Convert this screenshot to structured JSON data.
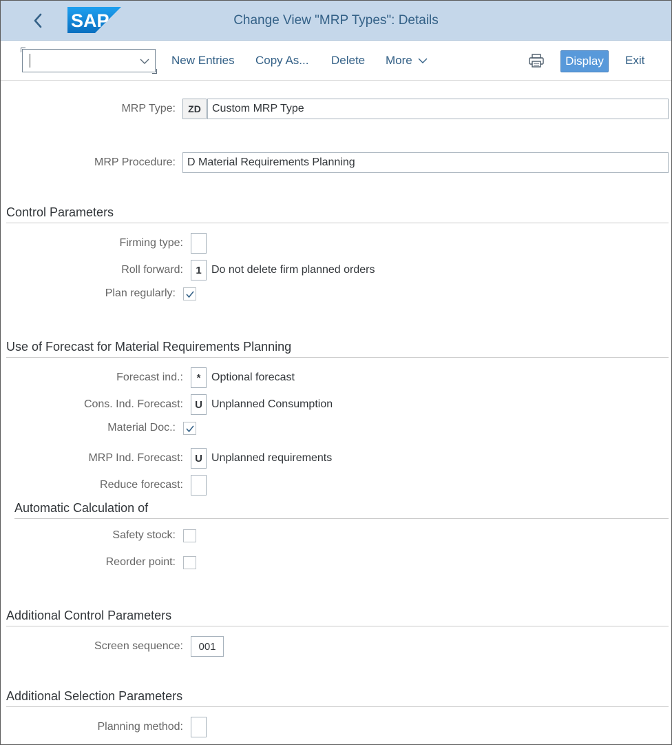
{
  "header": {
    "title": "Change View \"MRP Types\": Details",
    "logo_text": "SAP"
  },
  "toolbar": {
    "command_value": "",
    "new_entries": "New Entries",
    "copy_as": "Copy As...",
    "delete": "Delete",
    "more": "More",
    "display": "Display",
    "exit": "Exit"
  },
  "form": {
    "mrp_type_label": "MRP Type:",
    "mrp_type_code": "ZD",
    "mrp_type_desc": "Custom MRP Type",
    "mrp_procedure_label": "MRP Procedure:",
    "mrp_procedure_value": "D Material Requirements Planning"
  },
  "control": {
    "title": "Control Parameters",
    "firming_type_label": "Firming type:",
    "firming_type_value": "",
    "roll_forward_label": "Roll forward:",
    "roll_forward_value": "1",
    "roll_forward_desc": "Do not delete firm planned orders",
    "plan_regularly_label": "Plan regularly:",
    "plan_regularly_checked": true
  },
  "forecast": {
    "title": "Use of Forecast for Material Requirements Planning",
    "forecast_ind_label": "Forecast ind.:",
    "forecast_ind_value": "*",
    "forecast_ind_desc": "Optional forecast",
    "cons_ind_label": "Cons. Ind. Forecast:",
    "cons_ind_value": "U",
    "cons_ind_desc": "Unplanned Consumption",
    "material_doc_label": "Material Doc.:",
    "material_doc_checked": true,
    "mrp_ind_label": "MRP Ind. Forecast:",
    "mrp_ind_value": "U",
    "mrp_ind_desc": "Unplanned requirements",
    "reduce_label": "Reduce forecast:",
    "reduce_value": ""
  },
  "auto_calc": {
    "title": "Automatic Calculation of",
    "safety_stock_label": "Safety stock:",
    "safety_stock_checked": false,
    "reorder_point_label": "Reorder point:",
    "reorder_point_checked": false
  },
  "additional_control": {
    "title": "Additional Control Parameters",
    "screen_sequence_label": "Screen sequence:",
    "screen_sequence_value": "001"
  },
  "additional_selection": {
    "title": "Additional Selection Parameters",
    "planning_method_label": "Planning method:",
    "planning_method_value": ""
  },
  "colors": {
    "shell_bg": "#c5d7ea",
    "title_color": "#346187",
    "emphasized_button": "#5899da",
    "sap_logo": "#1a8de0"
  }
}
